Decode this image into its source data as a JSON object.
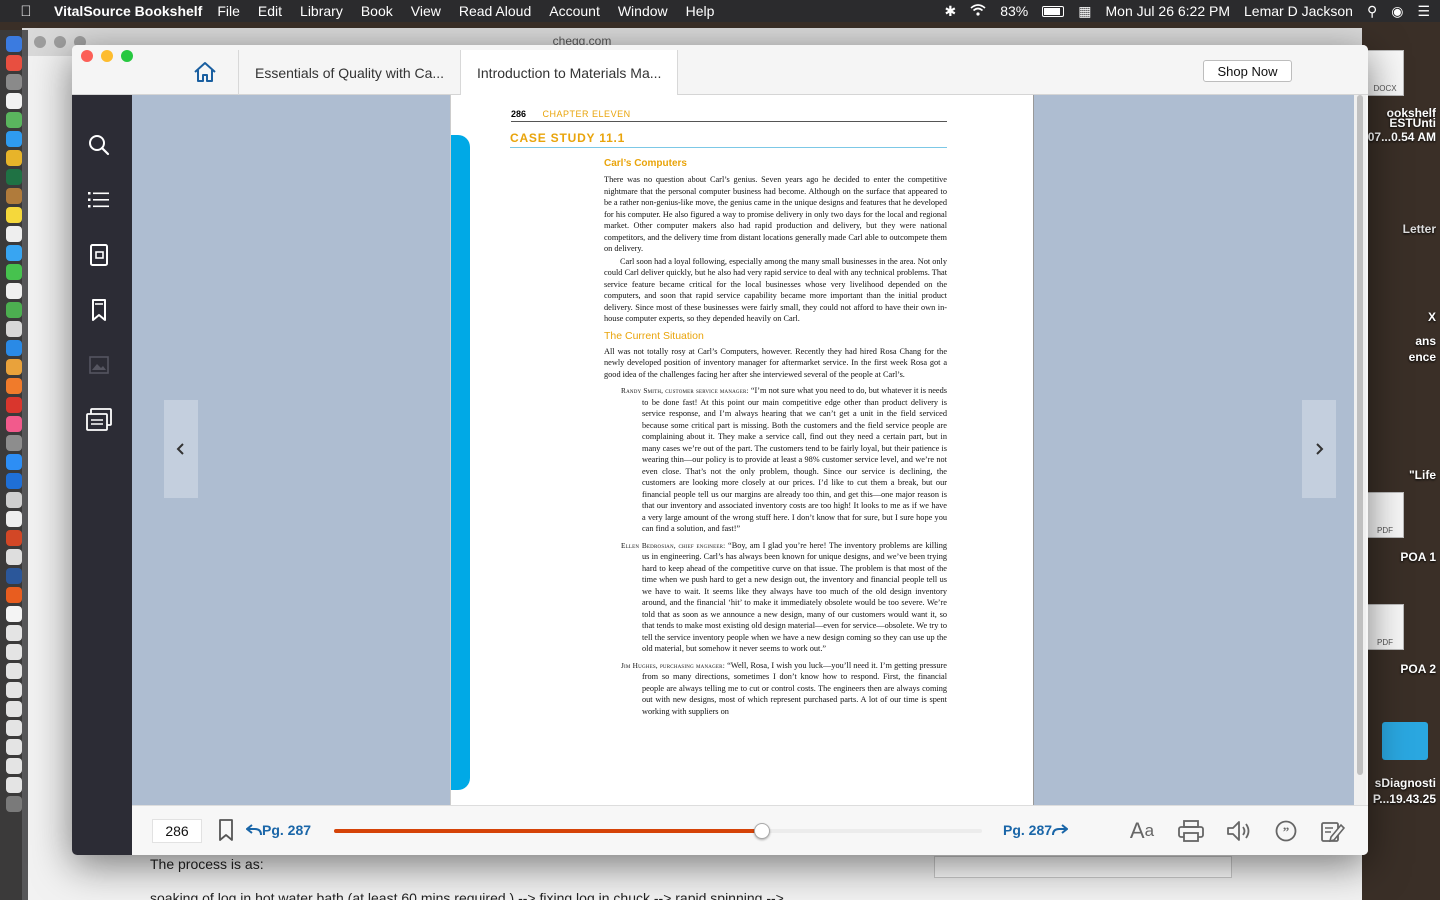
{
  "menubar": {
    "app": "VitalSource Bookshelf",
    "items": [
      "File",
      "Edit",
      "Library",
      "Book",
      "View",
      "Read Aloud",
      "Account",
      "Window",
      "Help"
    ],
    "battery": "83%",
    "datetime": "Mon Jul 26  6:22 PM",
    "user": "Lemar D Jackson"
  },
  "background_window": {
    "url": "chegg.com",
    "text1": "The process is as:",
    "text2": "soaking of log in hot water bath (at least 60 mins required ) --> fixing log in chuck --> rapid spinning -->"
  },
  "desktop": {
    "labels": [
      "DOCX",
      "ookshelf",
      "ESTUnti",
      "07...0.54 AM",
      "Letter",
      "X",
      "ans",
      "ence",
      "\"Life",
      "PDF",
      "POA 1",
      "PDF",
      "POA 2",
      "sDiagnosti",
      "P...19.43.25"
    ]
  },
  "tabs": {
    "tab1": "Essentials of Quality with Ca...",
    "tab2": "Introduction to Materials Ma..."
  },
  "shop_now": "Shop Now",
  "page": {
    "number": "286",
    "chapter": "CHAPTER ELEVEN",
    "case_study": "CASE STUDY 11.1",
    "heading": "Carl’s Computers",
    "para1": "There was no question about Carl’s genius. Seven years ago he decided to enter the competitive nightmare that the personal computer business had become. Although on the surface that appeared to be a rather non-genius-like move, the genius came in the unique designs and features that he developed for his computer. He also figured a way to promise delivery in only two days for the local and regional market. Other computer makers also had rapid production and delivery, but they were national competitors, and the delivery time from distant locations generally made Carl able to outcompete them on delivery.",
    "para2": "Carl soon had a loyal following, especially among the many small businesses in the area. Not only could Carl deliver quickly, but he also had very rapid service to deal with any technical problems. That service feature became critical for the local businesses whose very livelihood depended on the computers, and soon that rapid service capability became more important than the initial product delivery. Since most of these businesses were fairly small, they could not afford to have their own in-house computer experts, so they depended heavily on Carl.",
    "subheading": "The Current Situation",
    "para3": "All was not totally rosy at Carl’s Computers, however. Recently they had hired Rosa Chang for the newly developed position of inventory manager for aftermarket service. In the first week Rosa got a good idea of the challenges facing her after she interviewed several of the people at Carl’s.",
    "quotes": [
      {
        "speaker": "Randy Smith, customer service manager:",
        "text": " “I’m not sure what you need to do, but whatever it is needs to be done fast! At this point our main competitive edge other than product delivery is service response, and I’m always hearing that we can’t get a unit in the field serviced because some critical part is missing. Both the customers and the field service people are complaining about it. They make a service call, find out they need a certain part, but in many cases we’re out of the part. The customers tend to be fairly loyal, but their patience is wearing thin—our policy is to provide at least a 98% customer service level, and we’re not even close. That’s not the only problem, though. Since our service is declining, the customers are looking more closely at our prices. I’d like to cut them a break, but our financial people tell us our margins are already too thin, and get this—one major reason is that our inventory and associated inventory costs are too high! It looks to me as if we have a very large amount of the wrong stuff here. I don’t know that for sure, but I sure hope you can find a solution, and fast!”"
      },
      {
        "speaker": "Ellen Bedrosian, chief engineer:",
        "text": " “Boy, am I glad you’re here! The inventory problems are killing us in engineering. Carl’s has always been known for unique designs, and we’ve been trying hard to keep ahead of the competitive curve on that issue. The problem is that most of the time when we push hard to get a new design out, the inventory and financial people tell us we have to wait. It seems like they always have too much of the old design inventory around, and the financial ‘hit’ to make it immediately obsolete would be too severe. We’re told that as soon as we announce a new design, many of our customers would want it, so that tends to make most existing old design material—even for service—obsolete. We try to tell the service inventory people when we have a new design coming so they can use up the old material, but somehow it never seems to work out.”"
      },
      {
        "speaker": "Jim Hughes, purchasing manager:",
        "text": " “Well, Rosa, I wish you luck—you’ll need it. I’m getting pressure from so many directions, sometimes I don’t know how to respond. First, the financial people are always telling me to cut or control costs. The engineers then are always coming out with new designs, most of which represent purchased parts. A lot of our time is spent working with suppliers on"
      }
    ]
  },
  "bottom": {
    "page_input": "286",
    "prev_label": "Pg. 287",
    "next_label": "Pg. 287",
    "progress": 0.66,
    "accent": "#d54308"
  }
}
